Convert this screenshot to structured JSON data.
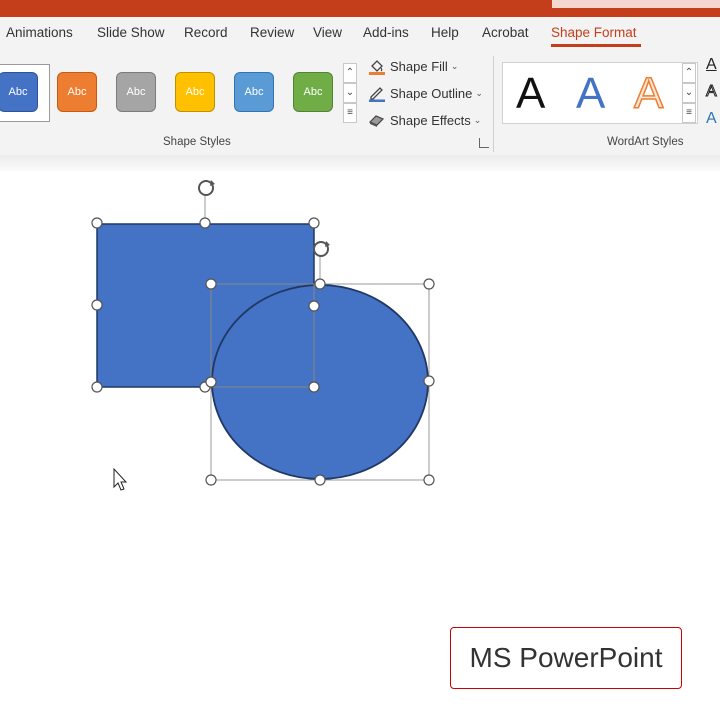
{
  "ribbon_tabs": [
    {
      "label": "Animations"
    },
    {
      "label": "Slide Show"
    },
    {
      "label": "Record"
    },
    {
      "label": "Review"
    },
    {
      "label": "View"
    },
    {
      "label": "Add-ins"
    },
    {
      "label": "Help"
    },
    {
      "label": "Acrobat"
    },
    {
      "label": "Shape Format",
      "active": true
    }
  ],
  "shape_styles": {
    "swatches": [
      {
        "label": "Abc",
        "color": "#4472c4"
      },
      {
        "label": "Abc",
        "color": "#ed7d31"
      },
      {
        "label": "Abc",
        "color": "#a5a5a5"
      },
      {
        "label": "Abc",
        "color": "#ffc000"
      },
      {
        "label": "Abc",
        "color": "#5b9bd5"
      },
      {
        "label": "Abc",
        "color": "#70ad47"
      }
    ],
    "commands": {
      "fill": "Shape Fill",
      "outline": "Shape Outline",
      "effects": "Shape Effects"
    },
    "group_label": "Shape Styles"
  },
  "wordart_styles": {
    "letters": [
      {
        "label": "A",
        "color": "#111111"
      },
      {
        "label": "A",
        "color": "#4472c4"
      },
      {
        "label": "A",
        "color": "#ed7d31"
      }
    ],
    "group_label": "WordArt Styles"
  },
  "slide": {
    "shape_fill": "#4472c4",
    "shape_outline": "#1f3864"
  },
  "brand": {
    "label": "MS PowerPoint"
  }
}
